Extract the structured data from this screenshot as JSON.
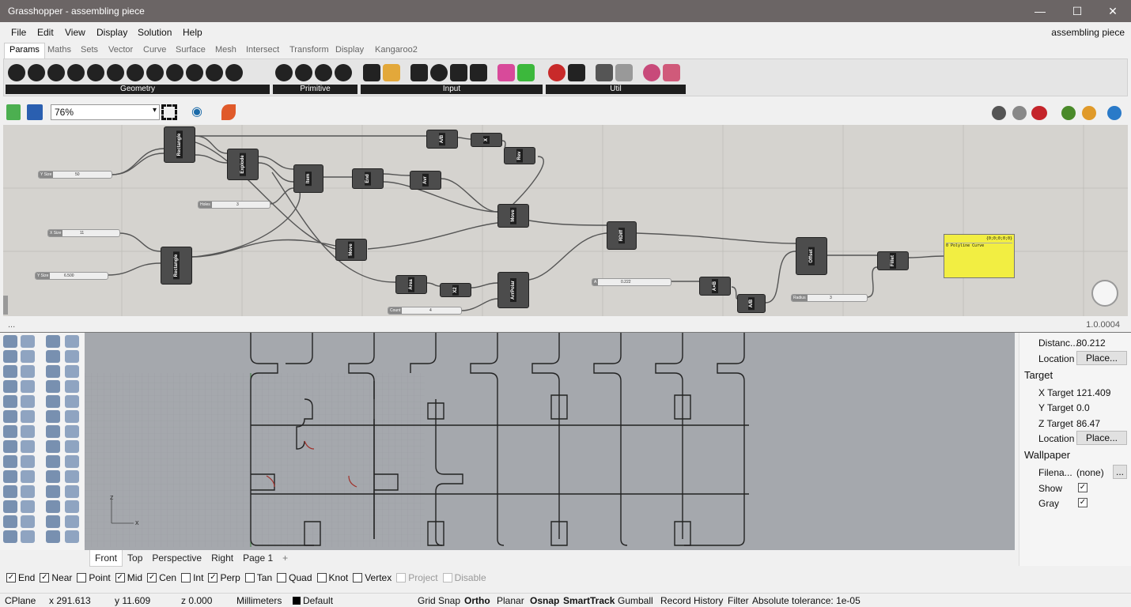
{
  "grasshopper": {
    "title": "Grasshopper - assembling piece",
    "document": "assembling piece",
    "menu": [
      "File",
      "Edit",
      "View",
      "Display",
      "Solution",
      "Help"
    ],
    "tabs": [
      "Params",
      "Maths",
      "Sets",
      "Vector",
      "Curve",
      "Surface",
      "Mesh",
      "Intersect",
      "Transform",
      "Display",
      "Kangaroo2"
    ],
    "groups": [
      "Geometry",
      "Primitive",
      "Input",
      "Util"
    ],
    "zoom": "76%",
    "version": "1.0.0004",
    "status_left": "...",
    "components": [
      {
        "id": "rect1",
        "label": "Rectangle"
      },
      {
        "id": "rect2",
        "label": "Rectangle"
      },
      {
        "id": "explode",
        "label": "Explode"
      },
      {
        "id": "item",
        "label": "Item"
      },
      {
        "id": "end",
        "label": "End"
      },
      {
        "id": "avr",
        "label": "Avr"
      },
      {
        "id": "div1",
        "label": "A/B"
      },
      {
        "id": "neg",
        "label": "X"
      },
      {
        "id": "rev",
        "label": "Rev"
      },
      {
        "id": "move1",
        "label": "Move"
      },
      {
        "id": "move2",
        "label": "Move"
      },
      {
        "id": "area",
        "label": "Area"
      },
      {
        "id": "x2",
        "label": "X2"
      },
      {
        "id": "arrpolar",
        "label": "ArrPolar"
      },
      {
        "id": "rdiff",
        "label": "RDiff"
      },
      {
        "id": "mul",
        "label": "A×B"
      },
      {
        "id": "div2",
        "label": "A/B"
      },
      {
        "id": "offset",
        "label": "Offset"
      },
      {
        "id": "fillet",
        "label": "Fillet"
      }
    ],
    "sliders": [
      {
        "label": "Y Size",
        "value": "50"
      },
      {
        "label": "Holes",
        "value": "3"
      },
      {
        "label": "X Size",
        "value": "11"
      },
      {
        "label": "Y Size",
        "value": "6.500"
      },
      {
        "label": "Count",
        "value": "4"
      },
      {
        "label": "A",
        "value": "0.222"
      },
      {
        "label": "Radius",
        "value": "3"
      }
    ],
    "panel": {
      "path": "{0;0;0;0;0}",
      "text": "0 Polyline Curve"
    }
  },
  "rhino": {
    "viewport_tabs": [
      "Front",
      "Top",
      "Perspective",
      "Right",
      "Page 1"
    ],
    "active_viewport": "Front",
    "add_tab": "+",
    "axis_x": "x",
    "axis_z": "z",
    "properties": {
      "distance_label": "Distanc...",
      "distance_value": "80.212",
      "location_label": "Location",
      "place_button": "Place...",
      "target_header": "Target",
      "x_label": "X Target",
      "x_value": "121.409",
      "y_label": "Y Target",
      "y_value": "0.0",
      "z_label": "Z Target",
      "z_value": "86.47",
      "location2_label": "Location",
      "place2_button": "Place...",
      "wallpaper_header": "Wallpaper",
      "filename_label": "Filena...",
      "filename_value": "(none)",
      "browse": "...",
      "show_label": "Show",
      "gray_label": "Gray"
    },
    "osnaps": [
      {
        "label": "End",
        "checked": true
      },
      {
        "label": "Near",
        "checked": true
      },
      {
        "label": "Point",
        "checked": false
      },
      {
        "label": "Mid",
        "checked": true
      },
      {
        "label": "Cen",
        "checked": true
      },
      {
        "label": "Int",
        "checked": false
      },
      {
        "label": "Perp",
        "checked": true
      },
      {
        "label": "Tan",
        "checked": false
      },
      {
        "label": "Quad",
        "checked": false
      },
      {
        "label": "Knot",
        "checked": false
      },
      {
        "label": "Vertex",
        "checked": false
      },
      {
        "label": "Project",
        "checked": false,
        "disabled": true
      },
      {
        "label": "Disable",
        "checked": false,
        "disabled": true
      }
    ],
    "status": {
      "cplane": "CPlane",
      "x": "x 291.613",
      "y": "y 11.609",
      "z": "z 0.000",
      "units": "Millimeters",
      "layer": "Default",
      "grid_snap": "Grid Snap",
      "ortho": "Ortho",
      "planar": "Planar",
      "osnap": "Osnap",
      "smarttrack": "SmartTrack",
      "gumball": "Gumball",
      "record_history": "Record History",
      "filter": "Filter",
      "tolerance": "Absolute tolerance: 1e-05"
    }
  },
  "colors": {
    "titlebar": "#6b6565",
    "canvas": "#d5d3cf",
    "viewport": "#a5a8ad",
    "panel": "#f2ee42",
    "component": "#4c4c4c"
  }
}
